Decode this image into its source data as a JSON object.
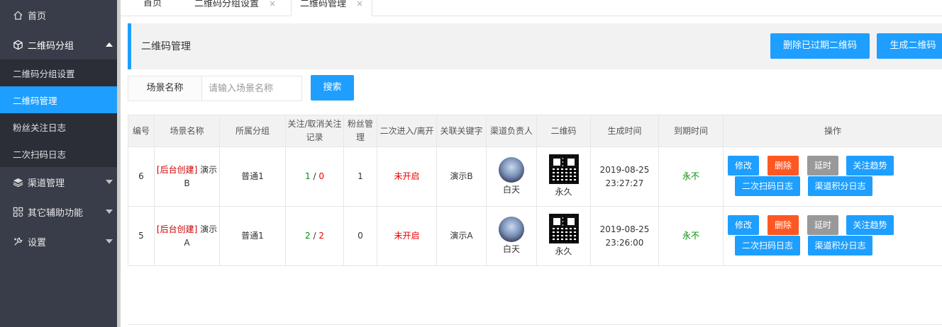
{
  "sidebar": {
    "items": [
      {
        "label": "首页",
        "icon": "home-icon"
      },
      {
        "label": "二维码分组",
        "icon": "cube-icon"
      },
      {
        "label": "渠道管理",
        "icon": "layers-icon"
      },
      {
        "label": "其它辅助功能",
        "icon": "apps-icon"
      },
      {
        "label": "设置",
        "icon": "wrench-icon"
      }
    ],
    "sub_items": [
      "二维码分组设置",
      "二维码管理",
      "粉丝关注日志",
      "二次扫码日志"
    ]
  },
  "tabs": [
    {
      "label": "首页"
    },
    {
      "label": "二维码分组设置",
      "close": "×"
    },
    {
      "label": "二维码管理",
      "close": "×"
    }
  ],
  "panel": {
    "title": "二维码管理",
    "delete_expired_label": "删除已过期二维码",
    "generate_label": "生成二维码"
  },
  "search": {
    "label": "场景名称",
    "placeholder": "请输入场景名称",
    "button_label": "搜索"
  },
  "table": {
    "headers": [
      "编号",
      "场景名称",
      "所属分组",
      "关注/取消关注记录",
      "粉丝管理",
      "二次进入/离开",
      "关联关键字",
      "渠道负责人",
      "二维码",
      "生成时间",
      "到期时间",
      "操作"
    ],
    "rows": [
      {
        "id": "6",
        "scene_tag": "[后台创建]",
        "scene_name": "演示B",
        "group": "普通1",
        "follow": "1",
        "sep": "/",
        "unfollow": "0",
        "fans": "1",
        "second_entry": "未开启",
        "keyword": "演示B",
        "owner": "白天",
        "qr_label": "永久",
        "created_date": "2019-08-25",
        "created_time": "23:27:27",
        "expire": "永不"
      },
      {
        "id": "5",
        "scene_tag": "[后台创建]",
        "scene_name": "演示A",
        "group": "普通1",
        "follow": "2",
        "sep": "/",
        "unfollow": "2",
        "fans": "0",
        "second_entry": "未开启",
        "keyword": "演示A",
        "owner": "白天",
        "qr_label": "永久",
        "created_date": "2019-08-25",
        "created_time": "23:26:00",
        "expire": "永不"
      }
    ],
    "actions": {
      "edit": "修改",
      "delete": "删除",
      "delay": "延时",
      "trend": "关注趋势",
      "scan_log": "二次扫码日志",
      "points_log": "渠道积分日志"
    }
  },
  "colors": {
    "accent": "#1e9fff",
    "danger": "#ff5722",
    "muted": "#999999",
    "sidebar": "#393d49",
    "sidebar_sub": "#2b2e37"
  }
}
